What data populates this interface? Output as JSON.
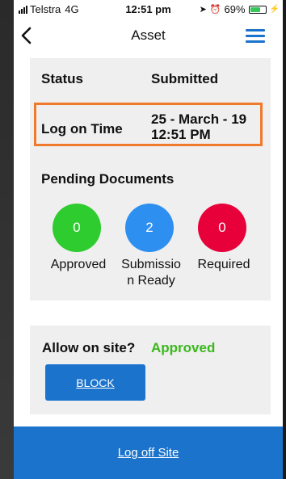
{
  "status_bar": {
    "carrier": "Telstra",
    "network": "4G",
    "time": "12:51 pm",
    "battery": "69%",
    "battery_level": 0.69
  },
  "nav": {
    "title": "Asset",
    "back_icon": "chevron-left-icon",
    "menu_icon": "hamburger-menu-icon"
  },
  "info": {
    "status_label": "Status",
    "status_value": "Submitted",
    "log_label": "Log on Time",
    "log_date": "25 - March - 19",
    "log_time": "12:51 PM"
  },
  "pending": {
    "title": "Pending Documents",
    "items": [
      {
        "count": "0",
        "label_line1": "Approved",
        "label_line2": "",
        "color": "#2ecc2e"
      },
      {
        "count": "2",
        "label_line1": "Submissio",
        "label_line2": "n Ready",
        "color": "#2d8ff0"
      },
      {
        "count": "0",
        "label_line1": "Required",
        "label_line2": "",
        "color": "#e8003a"
      }
    ]
  },
  "allow": {
    "label": "Allow on site?",
    "status": "Approved",
    "status_color": "#3ab81b",
    "block_label": "BLOCK"
  },
  "footer": {
    "log_off_label": "Log off Site"
  },
  "colors": {
    "primary": "#1b73cc",
    "highlight": "#ef7a2c",
    "card_bg": "#efefef"
  }
}
